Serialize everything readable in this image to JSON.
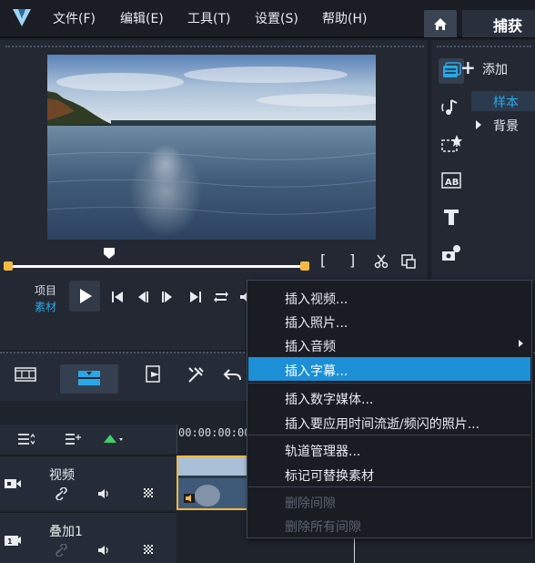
{
  "menubar": {
    "items": [
      {
        "label": "文件(F)"
      },
      {
        "label": "编辑(E)"
      },
      {
        "label": "工具(T)"
      },
      {
        "label": "设置(S)"
      },
      {
        "label": "帮助(H)"
      }
    ],
    "capture_tab": "捕获",
    "icons": [
      "app-logo",
      "home-icon"
    ]
  },
  "player": {
    "mode_project": "项目",
    "mode_clip": "素材",
    "mark_in": "[",
    "mark_out": "]",
    "colors": {
      "accent": "#2aa7e8",
      "trim": "#f5b942"
    }
  },
  "library": {
    "add_label": "添加",
    "selected_item": "样本",
    "item": "背景",
    "icons": [
      "media-icon",
      "audio-icon",
      "transition-icon",
      "title-ab-icon",
      "text-icon",
      "filter-icon"
    ]
  },
  "timeline": {
    "timecode": "00:00:00:00",
    "tracks": [
      {
        "name": "视频"
      },
      {
        "name": "叠加1"
      }
    ]
  },
  "context_menu": {
    "items": [
      {
        "label": "插入视频..."
      },
      {
        "label": "插入照片..."
      },
      {
        "label": "插入音频"
      },
      {
        "label": "插入字幕..."
      },
      {
        "label": "插入数字媒体..."
      },
      {
        "label": "插入要应用时间流逝/频闪的照片..."
      },
      {
        "label": "轨道管理器..."
      },
      {
        "label": "标记可替换素材"
      },
      {
        "label": "删除间隙"
      },
      {
        "label": "删除所有间隙"
      }
    ],
    "highlight_color": "#1c8fd6"
  }
}
